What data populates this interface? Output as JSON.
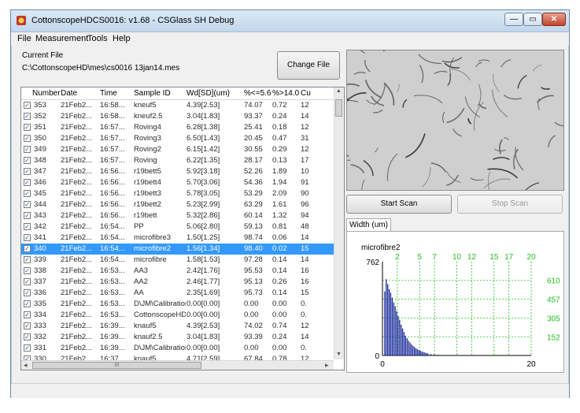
{
  "window": {
    "title": "CottonscopeHDCS0016: v1.68 - CSGlass SH Debug",
    "controls": {
      "minimize": "—",
      "maximize": "▭",
      "close": "✕"
    }
  },
  "menu": [
    "File",
    "Measurement",
    "Tools",
    "Help"
  ],
  "current_file": {
    "label": "Current File",
    "path": "C:\\CottonscopeHD\\mes\\cs0016 13jan14.mes",
    "change_button": "Change File"
  },
  "table": {
    "columns": [
      "Number",
      "Date",
      "Time",
      "Sample ID",
      "Wd[SD](um)",
      "%<=5.6",
      "%>14.0",
      "Cu"
    ],
    "rows": [
      [
        "353",
        "21Feb2...",
        "16:58...",
        "kneuf5",
        "4.39[2.53]",
        "74.07",
        "0.72",
        "12"
      ],
      [
        "352",
        "21Feb2...",
        "16:58...",
        "kneuf2.5",
        "3.04[1.83]",
        "93.37",
        "0.24",
        "14"
      ],
      [
        "351",
        "21Feb2...",
        "16:57...",
        "Roving4",
        "6.28[1.38]",
        "25.41",
        "0.18",
        "12"
      ],
      [
        "350",
        "21Feb2...",
        "16:57...",
        "Roving3",
        "6.50[1.43]",
        "20.45",
        "0.47",
        "31"
      ],
      [
        "349",
        "21Feb2...",
        "16:57...",
        "Roving2",
        "6.15[1.42]",
        "30.55",
        "0.29",
        "12"
      ],
      [
        "348",
        "21Feb2...",
        "16:57...",
        "Roving",
        "6.22[1.35]",
        "28.17",
        "0.13",
        "17"
      ],
      [
        "347",
        "21Feb2...",
        "16:56...",
        "r19bett5",
        "5.92[3.18]",
        "52.26",
        "1.89",
        "10"
      ],
      [
        "346",
        "21Feb2...",
        "16:56...",
        "r19bett4",
        "5.70[3.06]",
        "54.36",
        "1.94",
        "91"
      ],
      [
        "345",
        "21Feb2...",
        "16:56...",
        "r19bett3",
        "5.78[3.05]",
        "53.29",
        "2.09",
        "90"
      ],
      [
        "344",
        "21Feb2...",
        "16:56...",
        "r19bett2",
        "5.23[2.99]",
        "63.29",
        "1.61",
        "96"
      ],
      [
        "343",
        "21Feb2...",
        "16:56...",
        "r19bett",
        "5.32[2.86]",
        "60.14",
        "1.32",
        "94"
      ],
      [
        "342",
        "21Feb2...",
        "16:54...",
        "PP",
        "5.06[2.80]",
        "59.13",
        "0.81",
        "48"
      ],
      [
        "341",
        "21Feb2...",
        "16:54...",
        "microfibre3",
        "1.50[1.25]",
        "98.74",
        "0.06",
        "14"
      ],
      [
        "340",
        "21Feb2...",
        "16:54...",
        "microfibre2",
        "1.56[1.34]",
        "98.40",
        "0.02",
        "15"
      ],
      [
        "339",
        "21Feb2...",
        "16:54...",
        "microfibre",
        "1.58[1.53]",
        "97.28",
        "0.14",
        "14"
      ],
      [
        "338",
        "21Feb2...",
        "16:53...",
        "AA3",
        "2.42[1.76]",
        "95.53",
        "0.14",
        "16"
      ],
      [
        "337",
        "21Feb2...",
        "16:53...",
        "AA2",
        "2.46[1.77]",
        "95.13",
        "0.26",
        "16"
      ],
      [
        "336",
        "21Feb2...",
        "16:53...",
        "AA",
        "2.35[1.69]",
        "95.73",
        "0.14",
        "15"
      ],
      [
        "335",
        "21Feb2...",
        "16:53...",
        "D\\JM\\Calibration",
        "0.00[0.00]",
        "0.00",
        "0.00",
        "0."
      ],
      [
        "334",
        "21Feb2...",
        "16:53...",
        "CottonscopeHD\\JM",
        "0.00[0.00]",
        "0.00",
        "0.00",
        "0."
      ],
      [
        "333",
        "21Feb2...",
        "16:39...",
        "knauf5",
        "4.39[2.53]",
        "74.02",
        "0.74",
        "12"
      ],
      [
        "332",
        "21Feb2...",
        "16:39...",
        "knauf2.5",
        "3.04[1.83]",
        "93.39",
        "0.24",
        "14"
      ],
      [
        "331",
        "21Feb2...",
        "16:39...",
        "D\\JM\\Calibration",
        "0.00[0.00]",
        "0.00",
        "0.00",
        "0."
      ],
      [
        "330",
        "21Feb2...",
        "16:37...",
        "knauf5",
        "4.71[2.59]",
        "67.84",
        "0.78",
        "12"
      ]
    ],
    "selected_index": 13,
    "scroll_glyphs": {
      "up": "▲",
      "down": "▼",
      "left": "◂",
      "right": "▸",
      "grip": "III"
    }
  },
  "scan": {
    "start": "Start Scan",
    "stop": "Stop Scan"
  },
  "tab": {
    "label": "Width (um)"
  },
  "chart_data": {
    "type": "bar",
    "title": "microfibre2",
    "x_bottom_ticks": [
      "0",
      "20"
    ],
    "x_top_ticks": [
      "2",
      "5",
      "7",
      "10",
      "12",
      "15",
      "17",
      "20"
    ],
    "y_left_ticks": [
      "762",
      "0"
    ],
    "y_right_ticks": [
      "610",
      "457",
      "305",
      "152"
    ],
    "xlim": [
      0,
      20
    ],
    "ylim": [
      0,
      762
    ],
    "bars_x": [
      0.3,
      0.5,
      0.7,
      0.9,
      1.1,
      1.3,
      1.5,
      1.7,
      1.9,
      2.1,
      2.3,
      2.5,
      2.7,
      2.9,
      3.1,
      3.3,
      3.5,
      3.7,
      3.9,
      4.1,
      4.3,
      4.5,
      4.7,
      4.9,
      5.1,
      5.3,
      5.5,
      5.7,
      5.9,
      6.1,
      6.5,
      7.0,
      7.5,
      8.0
    ],
    "bars_y": [
      520,
      620,
      580,
      540,
      510,
      470,
      430,
      400,
      360,
      320,
      290,
      250,
      220,
      190,
      160,
      140,
      120,
      105,
      90,
      78,
      68,
      58,
      50,
      44,
      38,
      32,
      28,
      24,
      20,
      17,
      12,
      9,
      6,
      4
    ],
    "colors": {
      "bars": "#1a2a9a",
      "grid": "#22c022"
    }
  }
}
